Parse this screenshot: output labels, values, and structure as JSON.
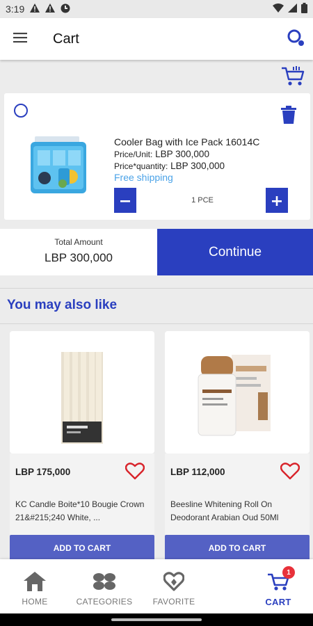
{
  "status_bar": {
    "time": "3:19"
  },
  "app_bar": {
    "title": "Cart"
  },
  "cart_item": {
    "name": "Cooler Bag with Ice Pack 16014C",
    "price_label": "Price/Unit:",
    "price_value": "LBP 300,000",
    "total_label": "Price*quantity:",
    "total_value": "LBP 300,000",
    "shipping": "Free shipping",
    "quantity": "1 PCE"
  },
  "summary": {
    "total_label": "Total Amount",
    "total_value": "LBP 300,000",
    "continue_label": "Continue"
  },
  "suggestions": {
    "title": "You may also like",
    "items": [
      {
        "price": "LBP 175,000",
        "name": "KC Candle Boite*10 Bougie Crown 21&#215;240 White, ...",
        "add_label": "ADD TO CART"
      },
      {
        "price": "LBP 112,000",
        "name": "Beesline Whitening Roll On Deodorant Arabian Oud 50Ml",
        "add_label": "ADD TO CART"
      }
    ]
  },
  "bottom_nav": {
    "items": [
      {
        "label": "HOME"
      },
      {
        "label": "CATEGORIES"
      },
      {
        "label": "FAVORITE"
      },
      {
        "label": "CART",
        "badge": "1"
      }
    ]
  },
  "colors": {
    "accent": "#2a3fbf",
    "add_button": "#5461c4",
    "free_shipping": "#4ba3e8",
    "heart": "#d8232a",
    "badge": "#e8313a"
  }
}
